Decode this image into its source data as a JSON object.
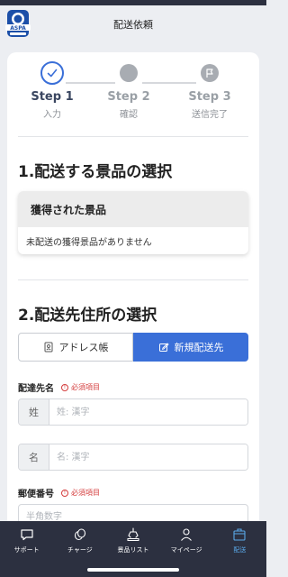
{
  "header": {
    "title": "配送依頼",
    "logo_text": "ASPA"
  },
  "stepper": [
    {
      "label": "Step 1",
      "sub": "入力",
      "state": "done"
    },
    {
      "label": "Step 2",
      "sub": "確認",
      "state": "pending"
    },
    {
      "label": "Step 3",
      "sub": "送信完了",
      "state": "pending"
    }
  ],
  "section1": {
    "title": "1.配送する景品の選択",
    "box_title": "獲得された景品",
    "empty_text": "未配送の獲得景品がありません"
  },
  "section2": {
    "title": "2.配送先住所の選択",
    "tab_address_book": "アドレス帳",
    "tab_new_address": "新規配送先"
  },
  "form": {
    "recipient_label": "配達先名",
    "required_text": "必須項目",
    "last_name_addon": "姓",
    "last_name_placeholder": "姓: 漢字",
    "first_name_addon": "名",
    "first_name_placeholder": "名: 漢字",
    "postal_label": "郵便番号",
    "postal_placeholder": "半角数字"
  },
  "nav": {
    "support": "サポート",
    "charge": "チャージ",
    "prize_list": "景品リスト",
    "mypage": "マイページ",
    "delivery": "配送"
  },
  "colors": {
    "accent": "#3a6fd8",
    "nav_bg": "#2c3040",
    "required": "#d43c3c",
    "nav_active": "#5aa8e8"
  }
}
